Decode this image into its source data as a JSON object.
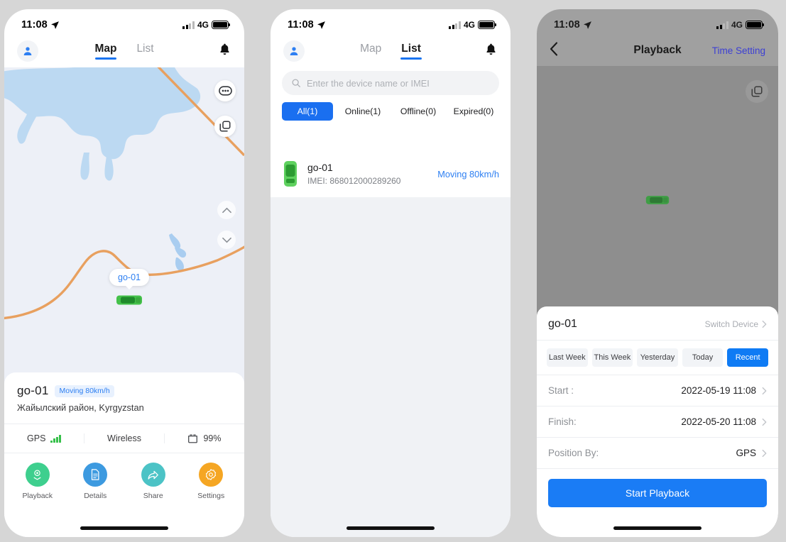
{
  "status_bar": {
    "time": "11:08",
    "network": "4G"
  },
  "screen1": {
    "nav": {
      "profile_icon": "person-icon",
      "tabs": [
        {
          "label": "Map",
          "active": true
        },
        {
          "label": "List",
          "active": false
        }
      ],
      "bell_icon": "bell-icon"
    },
    "map": {
      "marker_label": "go-01",
      "controls": [
        "dots-icon",
        "layers-icon",
        "zoom-in-icon",
        "zoom-out-icon",
        "compass-icon",
        "locate-icon"
      ]
    },
    "card": {
      "device_name": "go-01",
      "status_badge": "Moving 80km/h",
      "address": "Жайылский район, Kyrgyzstan",
      "stats": [
        {
          "label": "GPS",
          "icon": "signal-icon"
        },
        {
          "label": "Wireless",
          "icon": ""
        },
        {
          "label": "99%",
          "icon": "battery-icon"
        }
      ],
      "actions": [
        {
          "label": "Playback",
          "icon": "playback-icon",
          "color": "#3ecf8e"
        },
        {
          "label": "Details",
          "icon": "document-icon",
          "color": "#3d9ae0"
        },
        {
          "label": "Share",
          "icon": "share-icon",
          "color": "#4cc3c6"
        },
        {
          "label": "Settings",
          "icon": "gear-icon",
          "color": "#f5a623"
        }
      ]
    }
  },
  "screen2": {
    "nav": {
      "profile_icon": "person-icon",
      "tabs": [
        {
          "label": "Map",
          "active": false
        },
        {
          "label": "List",
          "active": true
        }
      ],
      "bell_icon": "bell-icon"
    },
    "search": {
      "placeholder": "Enter the device name or IMEI",
      "value": "",
      "icon": "search-icon"
    },
    "filters": [
      {
        "label": "All(1)",
        "active": true
      },
      {
        "label": "Online(1)",
        "active": false
      },
      {
        "label": "Offline(0)",
        "active": false
      },
      {
        "label": "Expired(0)",
        "active": false
      }
    ],
    "devices": [
      {
        "name": "go-01",
        "imei_label": "IMEI:",
        "imei": "868012000289260",
        "status": "Moving 80km/h",
        "icon": "car-icon"
      }
    ]
  },
  "screen3": {
    "header": {
      "back_icon": "back-chevron-icon",
      "title": "Playback",
      "action": "Time Setting"
    },
    "map": {
      "layers_icon": "layers-icon",
      "car_icon": "car-icon"
    },
    "card": {
      "device_name": "go-01",
      "switch_device": "Switch Device",
      "quick_ranges": [
        {
          "label": "Last Week",
          "active": false
        },
        {
          "label": "This Week",
          "active": false
        },
        {
          "label": "Yesterday",
          "active": false
        },
        {
          "label": "Today",
          "active": false
        },
        {
          "label": "Recent",
          "active": true
        }
      ],
      "rows": [
        {
          "label": "Start :",
          "value": "2022-05-19 11:08"
        },
        {
          "label": "Finish:",
          "value": "2022-05-20 11:08"
        },
        {
          "label": "Position By:",
          "value": "GPS"
        }
      ],
      "start_button": "Start Playback"
    }
  },
  "colors": {
    "accent_blue": "#1a7cf5",
    "link_blue": "#2d7ff2",
    "page_bg": "#d6d6d6",
    "map_bg": "#edf0f7",
    "road": "#e8a05f",
    "water": "#bcd9f2"
  }
}
